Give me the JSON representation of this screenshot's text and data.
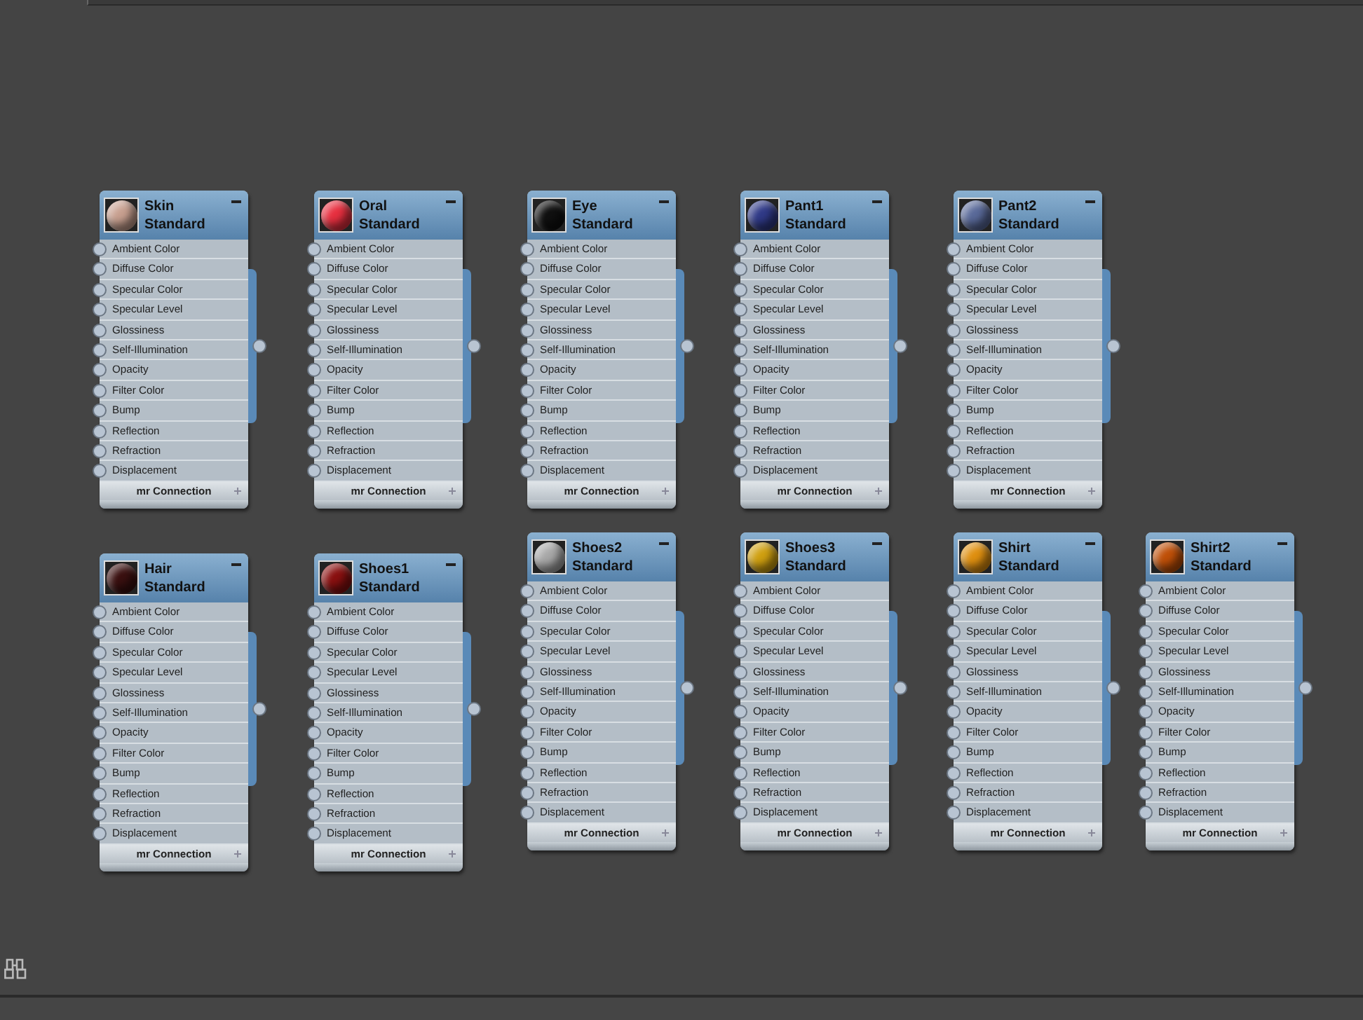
{
  "nodes": [
    {
      "name": "Skin",
      "type": "Standard",
      "color": "#c8a090",
      "slots": [
        "Ambient Color",
        "Diffuse Color",
        "Specular Color",
        "Specular Level",
        "Glossiness",
        "Self-Illumination",
        "Opacity",
        "Filter Color",
        "Bump",
        "Reflection",
        "Refraction",
        "Displacement"
      ],
      "footer": "mr Connection"
    },
    {
      "name": "Oral",
      "type": "Standard",
      "color": "#e83040",
      "slots": [
        "Ambient Color",
        "Diffuse Color",
        "Specular Color",
        "Specular Level",
        "Glossiness",
        "Self-Illumination",
        "Opacity",
        "Filter Color",
        "Bump",
        "Reflection",
        "Refraction",
        "Displacement"
      ],
      "footer": "mr Connection"
    },
    {
      "name": "Eye",
      "type": "Standard",
      "color": "#101010",
      "slots": [
        "Ambient Color",
        "Diffuse Color",
        "Specular Color",
        "Specular Level",
        "Glossiness",
        "Self-Illumination",
        "Opacity",
        "Filter Color",
        "Bump",
        "Reflection",
        "Refraction",
        "Displacement"
      ],
      "footer": "mr Connection"
    },
    {
      "name": "Pant1",
      "type": "Standard",
      "color": "#303a88",
      "slots": [
        "Ambient Color",
        "Diffuse Color",
        "Specular Color",
        "Specular Level",
        "Glossiness",
        "Self-Illumination",
        "Opacity",
        "Filter Color",
        "Bump",
        "Reflection",
        "Refraction",
        "Displacement"
      ],
      "footer": "mr Connection"
    },
    {
      "name": "Pant2",
      "type": "Standard",
      "color": "#5a6a9a",
      "slots": [
        "Ambient Color",
        "Diffuse Color",
        "Specular Color",
        "Specular Level",
        "Glossiness",
        "Self-Illumination",
        "Opacity",
        "Filter Color",
        "Bump",
        "Reflection",
        "Refraction",
        "Displacement"
      ],
      "footer": "mr Connection"
    },
    {
      "name": "Hair",
      "type": "Standard",
      "color": "#3a1010",
      "slots": [
        "Ambient Color",
        "Diffuse Color",
        "Specular Color",
        "Specular Level",
        "Glossiness",
        "Self-Illumination",
        "Opacity",
        "Filter Color",
        "Bump",
        "Reflection",
        "Refraction",
        "Displacement"
      ],
      "footer": "mr Connection"
    },
    {
      "name": "Shoes1",
      "type": "Standard",
      "color": "#8a1010",
      "slots": [
        "Ambient Color",
        "Diffuse Color",
        "Specular Color",
        "Specular Level",
        "Glossiness",
        "Self-Illumination",
        "Opacity",
        "Filter Color",
        "Bump",
        "Reflection",
        "Refraction",
        "Displacement"
      ],
      "footer": "mr Connection"
    },
    {
      "name": "Shoes2",
      "type": "Standard",
      "color": "#a8a8a8",
      "slots": [
        "Ambient Color",
        "Diffuse Color",
        "Specular Color",
        "Specular Level",
        "Glossiness",
        "Self-Illumination",
        "Opacity",
        "Filter Color",
        "Bump",
        "Reflection",
        "Refraction",
        "Displacement"
      ],
      "footer": "mr Connection"
    },
    {
      "name": "Shoes3",
      "type": "Standard",
      "color": "#d0a010",
      "slots": [
        "Ambient Color",
        "Diffuse Color",
        "Specular Color",
        "Specular Level",
        "Glossiness",
        "Self-Illumination",
        "Opacity",
        "Filter Color",
        "Bump",
        "Reflection",
        "Refraction",
        "Displacement"
      ],
      "footer": "mr Connection"
    },
    {
      "name": "Shirt",
      "type": "Standard",
      "color": "#e09010",
      "slots": [
        "Ambient Color",
        "Diffuse Color",
        "Specular Color",
        "Specular Level",
        "Glossiness",
        "Self-Illumination",
        "Opacity",
        "Filter Color",
        "Bump",
        "Reflection",
        "Refraction",
        "Displacement"
      ],
      "footer": "mr Connection"
    },
    {
      "name": "Shirt2",
      "type": "Standard",
      "color": "#c05008",
      "slots": [
        "Ambient Color",
        "Diffuse Color",
        "Specular Color",
        "Specular Level",
        "Glossiness",
        "Self-Illumination",
        "Opacity",
        "Filter Color",
        "Bump",
        "Reflection",
        "Refraction",
        "Displacement"
      ],
      "footer": "mr Connection"
    }
  ]
}
